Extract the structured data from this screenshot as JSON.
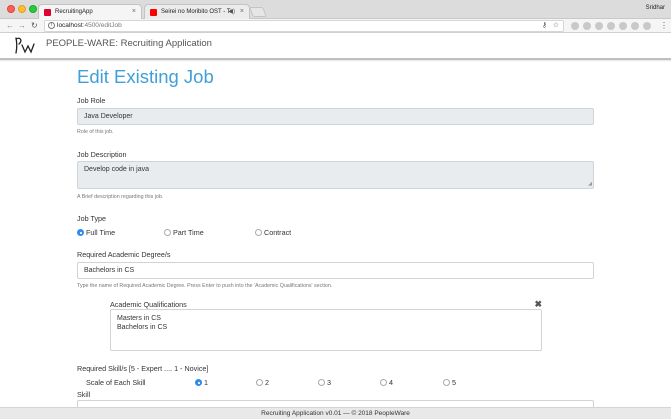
{
  "browser": {
    "tabs": [
      {
        "title": "RecruitingApp",
        "favicon_color": "#dd0031"
      },
      {
        "title": "Seirei no Moribito OST - To",
        "favicon_color": "#ff0000"
      }
    ],
    "user": "Sridhar",
    "url_host": "localhost",
    "url_path": ":4500/editJob"
  },
  "header": {
    "brand": "PEOPLE-WARE: Recruiting Application"
  },
  "page": {
    "title": "Edit Existing Job"
  },
  "form": {
    "job_role": {
      "label": "Job Role",
      "value": "Java Developer",
      "help": "Role of this job."
    },
    "job_description": {
      "label": "Job Description",
      "value": "Develop code in java",
      "help": "A Brief description regarding this job."
    },
    "job_type": {
      "label": "Job Type",
      "options": [
        "Full Time",
        "Part Time",
        "Contract"
      ],
      "selected": "Full Time"
    },
    "academic_degree": {
      "label": "Required Academic Degree/s",
      "value": "Bachelors in CS",
      "help": "Type the name of Required Academic Degree. Press Enter to push into the 'Academic Qualifications' section."
    },
    "academic_qualifications": {
      "title": "Academic Qualifications",
      "items": [
        "Masters in CS",
        "Bachelors in CS"
      ]
    },
    "skills": {
      "label": "Required Skill/s [5 - Expert .... 1 - Novice]",
      "scale_label": "Scale of Each Skill",
      "scale": [
        "1",
        "2",
        "3",
        "4",
        "5"
      ],
      "selected": "1",
      "skill_label": "Skill"
    }
  },
  "footer": {
    "text": "Recruiting Application v0.01 — © 2018 PeopleWare"
  }
}
